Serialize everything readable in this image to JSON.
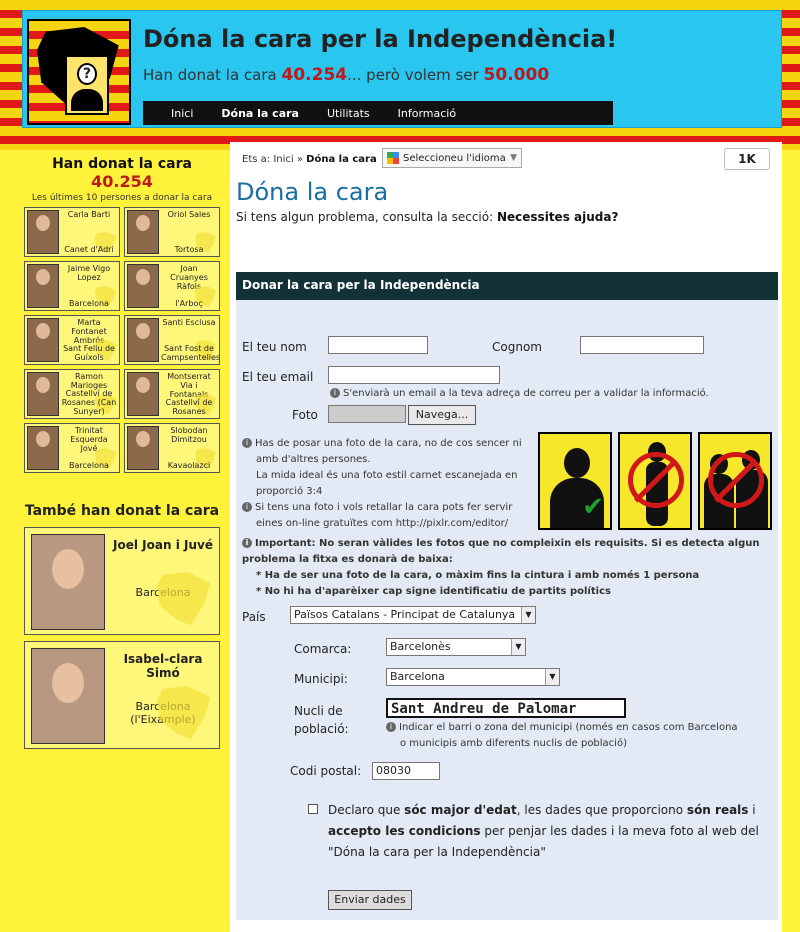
{
  "header": {
    "title": "Dóna la cara per la Independència!",
    "subtitle_prefix": "Han donat la cara",
    "count": "40.254",
    "subtitle_mid": "... però volem ser",
    "goal": "50.000",
    "nav": [
      "Inici",
      "Dóna la cara",
      "Utilitats",
      "Informació"
    ]
  },
  "sidebar": {
    "heading": "Han donat la cara",
    "count": "40.254",
    "sub": "Les últimes 10 persones a donar la cara",
    "people": [
      {
        "name": "Carla Barti",
        "city": "Canet d'Adri"
      },
      {
        "name": "Oriol Sales",
        "city": "Tortosa"
      },
      {
        "name": "Jaime Vigo Lopez",
        "city": "Barcelona"
      },
      {
        "name": "Joan Cruanyes Ràfols",
        "city": "l'Arboç"
      },
      {
        "name": "Marta Fontanet Ambrós",
        "city": "Sant Feliu de Guíxols"
      },
      {
        "name": "Santi Esclusa",
        "city": "Sant Fost de Campsentelles"
      },
      {
        "name": "Ramon Marioges",
        "city": "Castellví de Rosanes (Can Sunyer)"
      },
      {
        "name": "Montserrat Via i Fontanals",
        "city": "Castellví de Rosanes"
      },
      {
        "name": "Trinitat Esquerda Jové",
        "city": "Barcelona"
      },
      {
        "name": "Slobodan Dimitzou",
        "city": "Kavaolazci"
      }
    ],
    "heading2": "També han donat la cara",
    "featured": [
      {
        "name": "Joel Joan i Juvé",
        "city": "Barcelona"
      },
      {
        "name": "Isabel-clara Simó",
        "city": "Barcelona (l'Eixample)"
      }
    ]
  },
  "main": {
    "breadcrumb_prefix": "Ets a:",
    "breadcrumb_home": "Inici",
    "breadcrumb_sep": "»",
    "breadcrumb_current": "Dóna la cara",
    "lang_label": "Seleccioneu l'idioma",
    "fb_count": "1K",
    "page_title": "Dóna la cara",
    "help_prefix": "Si tens algun problema, consulta la secció:",
    "help_link": "Necessites ajuda?"
  },
  "form": {
    "heading": "Donar la cara per la Independència",
    "name_label": "El teu nom",
    "surname_label": "Cognom",
    "email_label": "El teu email",
    "email_note": "S'enviarà un email a la teva adreça de correu per a validar la informació.",
    "photo_label": "Foto",
    "browse_label": "Navega...",
    "tip1_a": "Has de posar una foto de la cara, no de cos sencer ni",
    "tip1_b": "amb d'altres persones.",
    "tip1_c": "La mida ideal és una foto estil carnet escanejada en",
    "tip1_d": "proporció 3:4",
    "tip2_a": "Si tens una foto i vols retallar la cara pots fer servir",
    "tip2_b": "eines on-line gratuïtes com http://pixlr.com/editor/",
    "important_a": "Important: No seran vàlides les fotos que no compleixin els requisits. Si es detecta algun",
    "important_b": "problema la fitxa es donarà de baixa:",
    "rule1": "* Ha de ser una foto de la cara, o màxim fins la cintura i amb només 1 persona",
    "rule2": "* No hi ha d'aparèixer cap signe identificatiu de partits polítics",
    "country_label": "País",
    "country_value": "Països Catalans - Principat de Catalunya",
    "comarca_label": "Comarca:",
    "comarca_value": "Barcelonès",
    "municipi_label": "Municipi:",
    "municipi_value": "Barcelona",
    "nucli_label_a": "Nucli de",
    "nucli_label_b": "població:",
    "nucli_value": "Sant Andreu de Palomar",
    "nucli_note_a": "Indicar el barri o zona del municipi (només en casos com Barcelona",
    "nucli_note_b": "o municipis amb diferents nuclis de població)",
    "postal_label": "Codi postal:",
    "postal_value": "08030",
    "consent_1": "Declaro que",
    "consent_2": "sóc major d'edat",
    "consent_3": ", les dades que proporciono",
    "consent_4": "són reals",
    "consent_5": "i",
    "consent_6": "accepto les condicions",
    "consent_7": "per penjar les dades i la meva foto al web del",
    "consent_8": "\"Dóna la cara per la Independència\"",
    "submit_label": "Enviar dades"
  }
}
